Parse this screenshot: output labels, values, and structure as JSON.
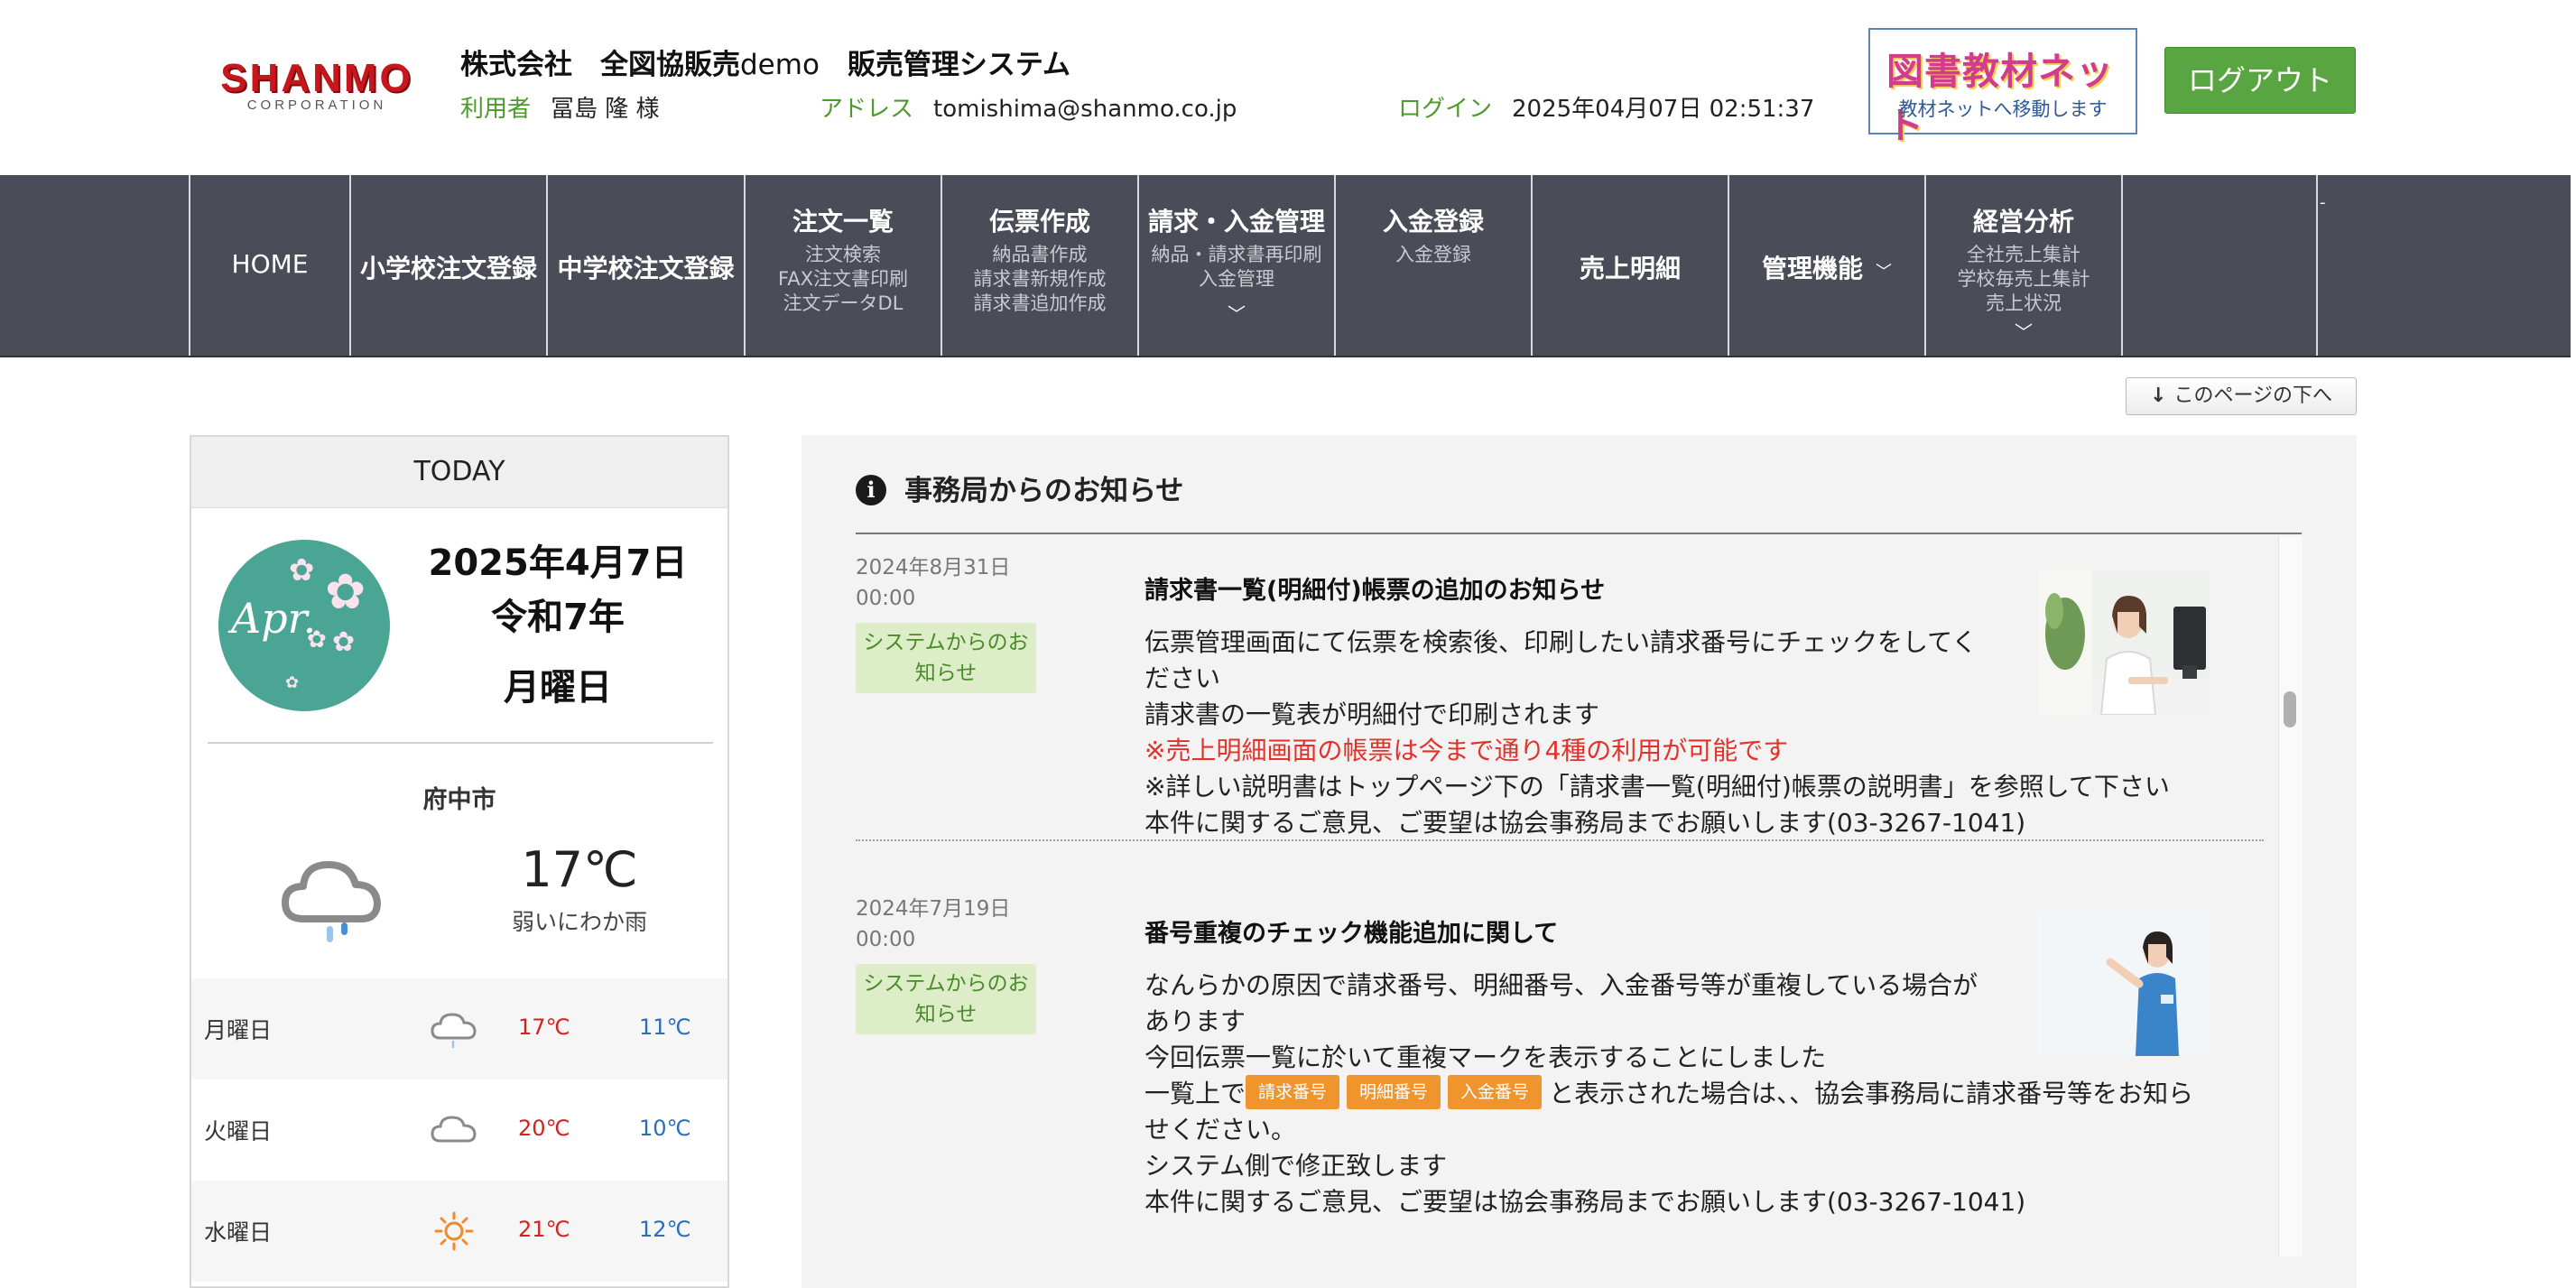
{
  "header": {
    "logo": "SHANMO",
    "logo_sub": "CORPORATION",
    "system_title_company": "株式会社　全図協販売",
    "system_title_demo": "demo",
    "system_title_name": "販売管理システム",
    "user_label": "利用者",
    "user_name": "冨島 隆 様",
    "address_label": "アドレス",
    "address_value": "tomishima@shanmo.co.jp",
    "login_label": "ログイン",
    "login_value": "2025年04月07日 02:51:37",
    "toshonet_logo": "図書教材ネット",
    "toshonet_sub": "教材ネットへ移動します",
    "logout_label": "ログアウト"
  },
  "nav": {
    "items": [
      {
        "title": "HOME"
      },
      {
        "title": "小学校注文登録"
      },
      {
        "title": "中学校注文登録"
      },
      {
        "title": "注文一覧",
        "sub": [
          "注文検索",
          "FAX注文書印刷",
          "注文データDL"
        ]
      },
      {
        "title": "伝票作成",
        "sub": [
          "納品書作成",
          "請求書新規作成",
          "請求書追加作成"
        ]
      },
      {
        "title": "請求・入金管理",
        "sub": [
          "納品・請求書再印刷",
          "入金管理"
        ]
      },
      {
        "title": "入金登録",
        "sub": [
          "入金登録"
        ]
      },
      {
        "title": "売上明細"
      },
      {
        "title": "管理機能"
      },
      {
        "title": "経営分析",
        "sub": [
          "全社売上集計",
          "学校毎売上集計",
          "売上状況"
        ]
      }
    ],
    "tick": "-"
  },
  "page_bottom_button": {
    "arrow": "↓",
    "label": "このページの下へ"
  },
  "today": {
    "heading": "TODAY",
    "month_badge": "Apr.",
    "date": "2025年4月7日",
    "era": "令和7年",
    "weekday": "月曜日",
    "city": "府中市",
    "temperature": "17℃",
    "condition": "弱いにわか雨",
    "forecast": [
      {
        "day": "月曜日",
        "icon": "cloud-rain-icon",
        "high": "17℃",
        "low": "11℃"
      },
      {
        "day": "火曜日",
        "icon": "cloud-icon",
        "high": "20℃",
        "low": "10℃"
      },
      {
        "day": "水曜日",
        "icon": "sun-icon",
        "high": "21℃",
        "low": "12℃"
      }
    ]
  },
  "notices": {
    "heading": "事務局からのお知らせ",
    "items": [
      {
        "date": "2024年8月31日",
        "time": "00:00",
        "badge_line1": "システムからのお",
        "badge_line2": "知らせ",
        "title": "請求書一覧(明細付)帳票の追加のお知らせ",
        "lines": [
          "伝票管理画面にて伝票を検索後、印刷したい請求番号にチェックをしてく",
          "ださい",
          "請求書の一覧表が明細付で印刷されます",
          "※売上明細画面の帳票は今まで通り4種の利用が可能です",
          "※詳しい説明書はトップページ下の「請求書一覧(明細付)帳票の説明書」を参照して下さい",
          "本件に関するご意見、ご要望は協会事務局までお願いします(03-3267-1041)"
        ]
      },
      {
        "date": "2024年7月19日",
        "time": "00:00",
        "badge_line1": "システムからのお",
        "badge_line2": "知らせ",
        "title": "番号重複のチェック機能追加に関して",
        "lines": [
          "なんらかの原因で請求番号、明細番号、入金番号等が重複している場合が",
          "あります",
          "今回伝票一覧に於いて重複マークを表示することにしました",
          "一覧上で",
          "と表示された場合は、、協会事務局に請求番号等をお知ら",
          "せください。",
          "システム側で修正致します",
          "本件に関するご意見、ご要望は協会事務局までお願いします(03-3267-1041)"
        ],
        "tags": [
          "請求番号",
          "明細番号",
          "入金番号"
        ]
      }
    ]
  },
  "colors": {
    "nav_bg": "#4a4d58",
    "accent_green": "#58a541",
    "label_green": "#4c9a2a",
    "notice_red": "#e2322a",
    "tag_orange": "#f0952d",
    "today_circle": "#4aa594"
  }
}
